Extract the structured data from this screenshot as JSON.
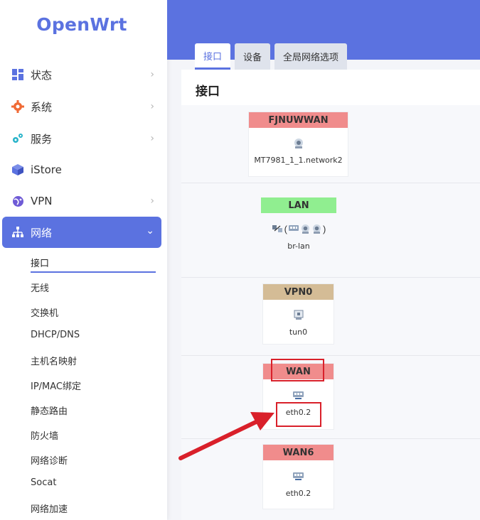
{
  "brand": {
    "logo_text": "OpenWrt",
    "accent": "#5b72e0"
  },
  "sidebar": {
    "items": [
      {
        "label": "状态",
        "icon": "dashboard-icon",
        "has_chevron": true
      },
      {
        "label": "系统",
        "icon": "gear-icon",
        "has_chevron": true
      },
      {
        "label": "服务",
        "icon": "cogs-icon",
        "has_chevron": true
      },
      {
        "label": "iStore",
        "icon": "cube-icon",
        "has_chevron": false
      },
      {
        "label": "VPN",
        "icon": "globe-icon",
        "has_chevron": true
      },
      {
        "label": "网络",
        "icon": "network-icon",
        "has_chevron": true,
        "active": true
      }
    ],
    "sub_items": [
      "接口",
      "无线",
      "交换机",
      "DHCP/DNS",
      "主机名映射",
      "IP/MAC绑定",
      "静态路由",
      "防火墙",
      "网络诊断",
      "Socat",
      "网络加速"
    ],
    "active_sub": "接口"
  },
  "tabs": [
    {
      "label": "接口",
      "active": true
    },
    {
      "label": "设备",
      "active": false
    },
    {
      "label": "全局网络选项",
      "active": false
    }
  ],
  "panel": {
    "title": "接口"
  },
  "interfaces": [
    {
      "name": "FJNUWWAN",
      "device": "MT7981_1_1.network2",
      "color": "#f08c8c",
      "icon": "wireless-adapter-icon"
    },
    {
      "name": "LAN",
      "device": "br-lan",
      "icons_text": "(",
      "icons_text_end": ")",
      "color": "#90ee90",
      "icon": "bridge-icon"
    },
    {
      "name": "VPN0",
      "device": "tun0",
      "color": "#d4bc96",
      "icon": "tunnel-icon"
    },
    {
      "name": "WAN",
      "device": "eth0.2",
      "color": "#f08c8c",
      "icon": "ethernet-switch-icon"
    },
    {
      "name": "WAN6",
      "device": "eth0.2",
      "color": "#f08c8c",
      "icon": "ethernet-switch-icon"
    }
  ],
  "annotation": {
    "color": "#d9202a"
  }
}
